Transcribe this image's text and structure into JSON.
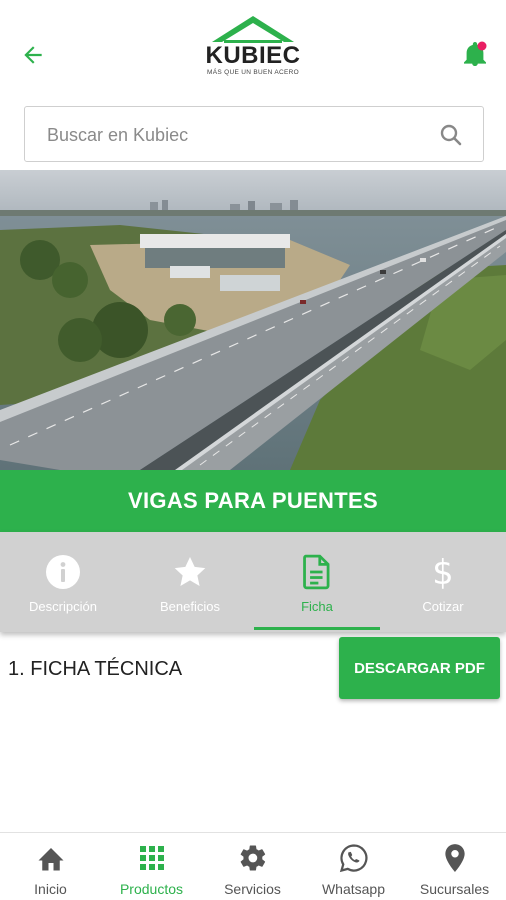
{
  "header": {
    "logo_name": "KUBIEC",
    "logo_tagline": "MÁS QUE UN BUEN ACERO",
    "back_icon": "arrow-left-icon",
    "notification_icon": "bell-icon",
    "notification_dot_color": "#e91e63"
  },
  "search": {
    "placeholder": "Buscar en Kubiec"
  },
  "product": {
    "title": "VIGAS PARA PUENTES",
    "hero_image": "highway-bridge-aerial"
  },
  "tabs": [
    {
      "label": "Descripción",
      "icon": "info-icon",
      "active": false
    },
    {
      "label": "Beneficios",
      "icon": "star-icon",
      "active": false
    },
    {
      "label": "Ficha",
      "icon": "document-icon",
      "active": true
    },
    {
      "label": "Cotizar",
      "icon": "dollar-icon",
      "active": false
    }
  ],
  "content": {
    "section_title": "1. FICHA TÉCNICA",
    "download_label": "DESCARGAR PDF"
  },
  "bottom_nav": [
    {
      "label": "Inicio",
      "icon": "home-icon",
      "active": false
    },
    {
      "label": "Productos",
      "icon": "grid-icon",
      "active": true
    },
    {
      "label": "Servicios",
      "icon": "gear-icon",
      "active": false
    },
    {
      "label": "Whatsapp",
      "icon": "whatsapp-icon",
      "active": false
    },
    {
      "label": "Sucursales",
      "icon": "location-pin-icon",
      "active": false
    }
  ],
  "colors": {
    "brand_green": "#2db14c",
    "tab_bar_gray": "#d1d1d1"
  }
}
